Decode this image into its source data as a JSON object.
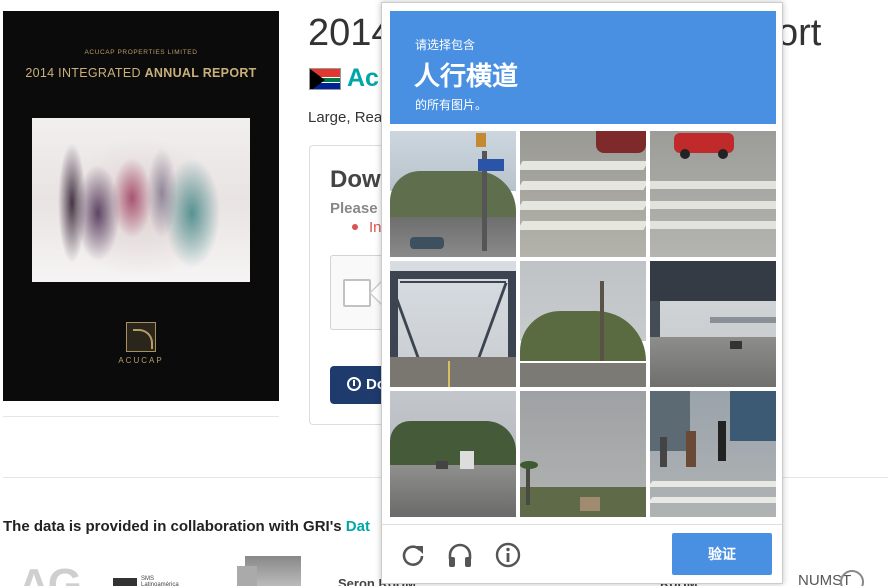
{
  "cover": {
    "company": "ACUCAP PROPERTIES LIMITED",
    "title_year": "2014",
    "title_plain": "INTEGRATED",
    "title_bold": "ANNUAL REPORT",
    "logo_text": "ACUCAP"
  },
  "page": {
    "title_left": "2014",
    "title_right": "ort",
    "org_name": "Ac",
    "subtext": "Large, Rea",
    "download": {
      "title": "Dow",
      "please": "Please",
      "error": "In",
      "button_label": "Do"
    },
    "gri_text": "The data is provided in collaboration with GRI's",
    "gri_link": "Dat"
  },
  "partners": {
    "ag": "AG",
    "sms": "SMS Latinoamérica",
    "misc1": "Seron   RoHM",
    "misc2": "RoHM",
    "numst": "NUMST"
  },
  "captcha": {
    "instruction": "请选择包含",
    "target": "人行横道",
    "suffix": "的所有图片。",
    "tiles": [
      {
        "name": "intersection-sign-scene"
      },
      {
        "name": "crosswalk-stripes-car"
      },
      {
        "name": "crosswalk-red-car"
      },
      {
        "name": "steel-truss-bridge"
      },
      {
        "name": "roadside-trees"
      },
      {
        "name": "highway-overpass"
      },
      {
        "name": "highway-trucks"
      },
      {
        "name": "road-with-palms"
      },
      {
        "name": "pedestrians-crosswalk"
      }
    ],
    "controls": {
      "reload": "reload-icon",
      "audio": "headphones-icon",
      "info": "info-icon"
    },
    "verify_label": "验证",
    "colors": {
      "accent": "#4a90e2"
    }
  }
}
